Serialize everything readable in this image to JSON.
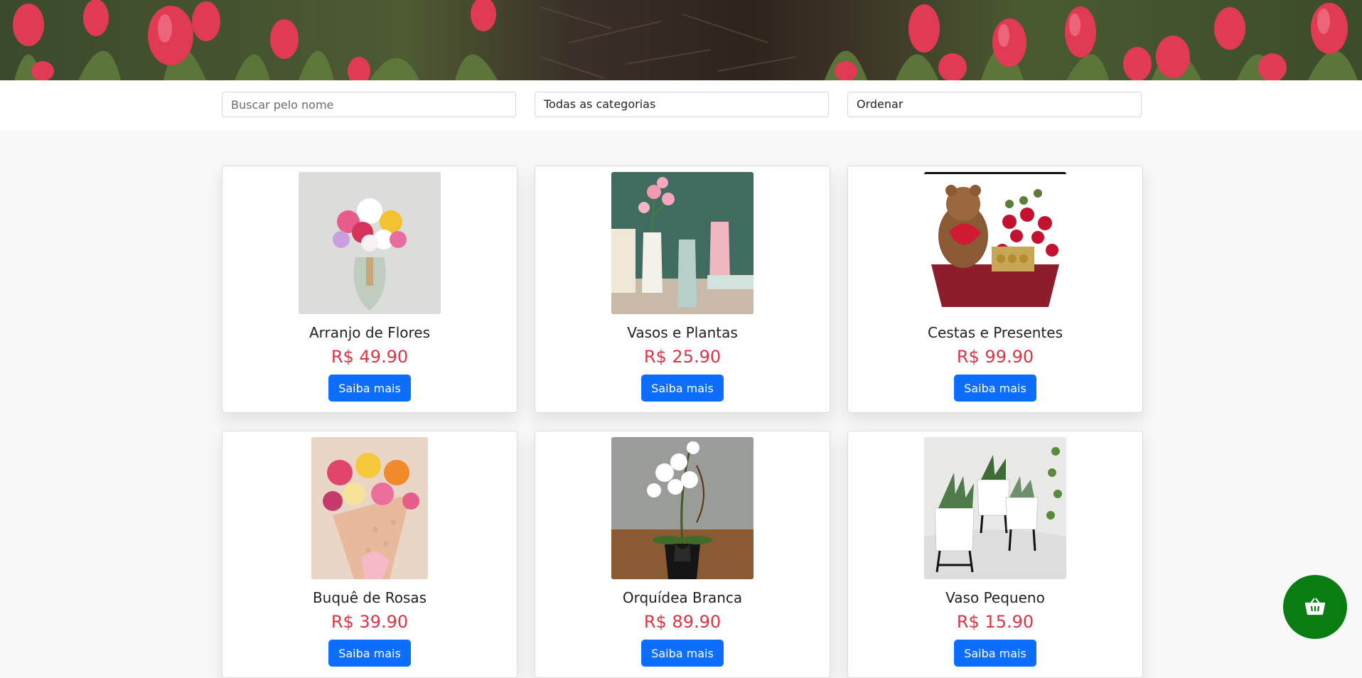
{
  "filters": {
    "search_placeholder": "Buscar pelo nome",
    "category_selected": "Todas as categorias",
    "order_selected": "Ordenar"
  },
  "products": [
    {
      "name": "Arranjo de Flores",
      "price": "R$ 49.90",
      "button": "Saiba mais"
    },
    {
      "name": "Vasos e Plantas",
      "price": "R$ 25.90",
      "button": "Saiba mais"
    },
    {
      "name": "Cestas e Presentes",
      "price": "R$ 99.90",
      "button": "Saiba mais"
    },
    {
      "name": "Buquê de Rosas",
      "price": "R$ 39.90",
      "button": "Saiba mais"
    },
    {
      "name": "Orquídea Branca",
      "price": "R$ 89.90",
      "button": "Saiba mais"
    },
    {
      "name": "Vaso Pequeno",
      "price": "R$ 15.90",
      "button": "Saiba mais"
    }
  ],
  "icons": {
    "cart": "shopping-basket-icon"
  },
  "colors": {
    "price": "#dc3545",
    "button": "#0d6efd",
    "cart_fab": "#0a7d12"
  }
}
